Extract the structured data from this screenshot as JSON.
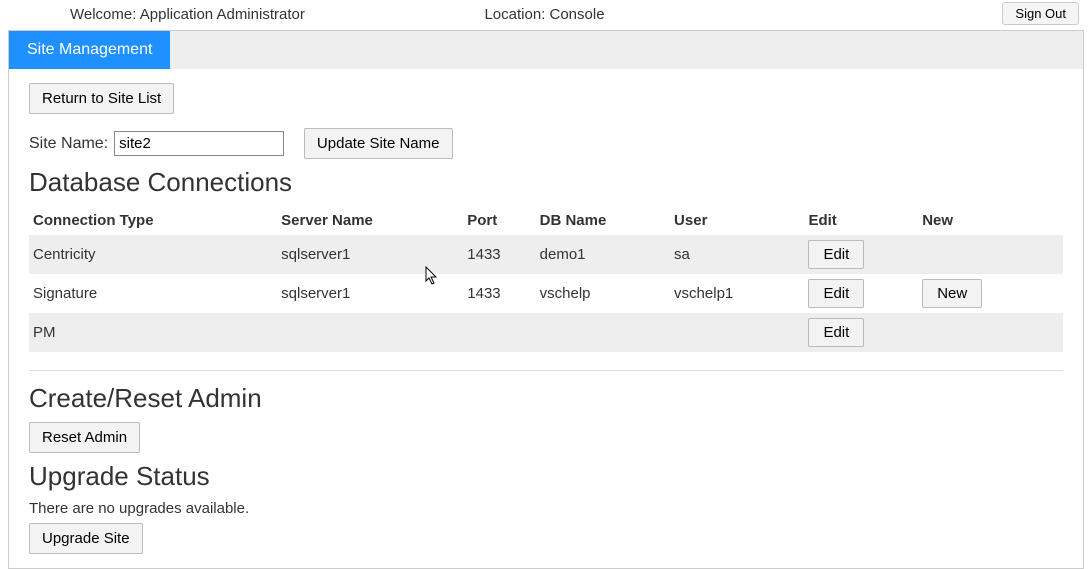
{
  "topbar": {
    "welcome": "Welcome: Application Administrator",
    "location": "Location: Console",
    "signout": "Sign Out"
  },
  "tab": {
    "label": "Site Management"
  },
  "actions": {
    "return_to_list": "Return to Site List",
    "update_site_name": "Update Site Name",
    "reset_admin": "Reset Admin",
    "upgrade_site": "Upgrade Site"
  },
  "site_name": {
    "label": "Site Name:",
    "value": "site2"
  },
  "sections": {
    "db_connections": "Database Connections",
    "create_reset_admin": "Create/Reset Admin",
    "upgrade_status": "Upgrade Status"
  },
  "table": {
    "headers": {
      "connection_type": "Connection Type",
      "server_name": "Server Name",
      "port": "Port",
      "db_name": "DB Name",
      "user": "User",
      "edit": "Edit",
      "new": "New"
    },
    "rows": [
      {
        "connection_type": "Centricity",
        "server_name": "sqlserver1",
        "port": "1433",
        "db_name": "demo1",
        "user": "sa",
        "edit": "Edit",
        "new": ""
      },
      {
        "connection_type": "Signature",
        "server_name": "sqlserver1",
        "port": "1433",
        "db_name": "vschelp",
        "user": "vschelp1",
        "edit": "Edit",
        "new": "New"
      },
      {
        "connection_type": "PM",
        "server_name": "",
        "port": "",
        "db_name": "",
        "user": "",
        "edit": "Edit",
        "new": ""
      }
    ]
  },
  "upgrade": {
    "status_text": "There are no upgrades available."
  }
}
